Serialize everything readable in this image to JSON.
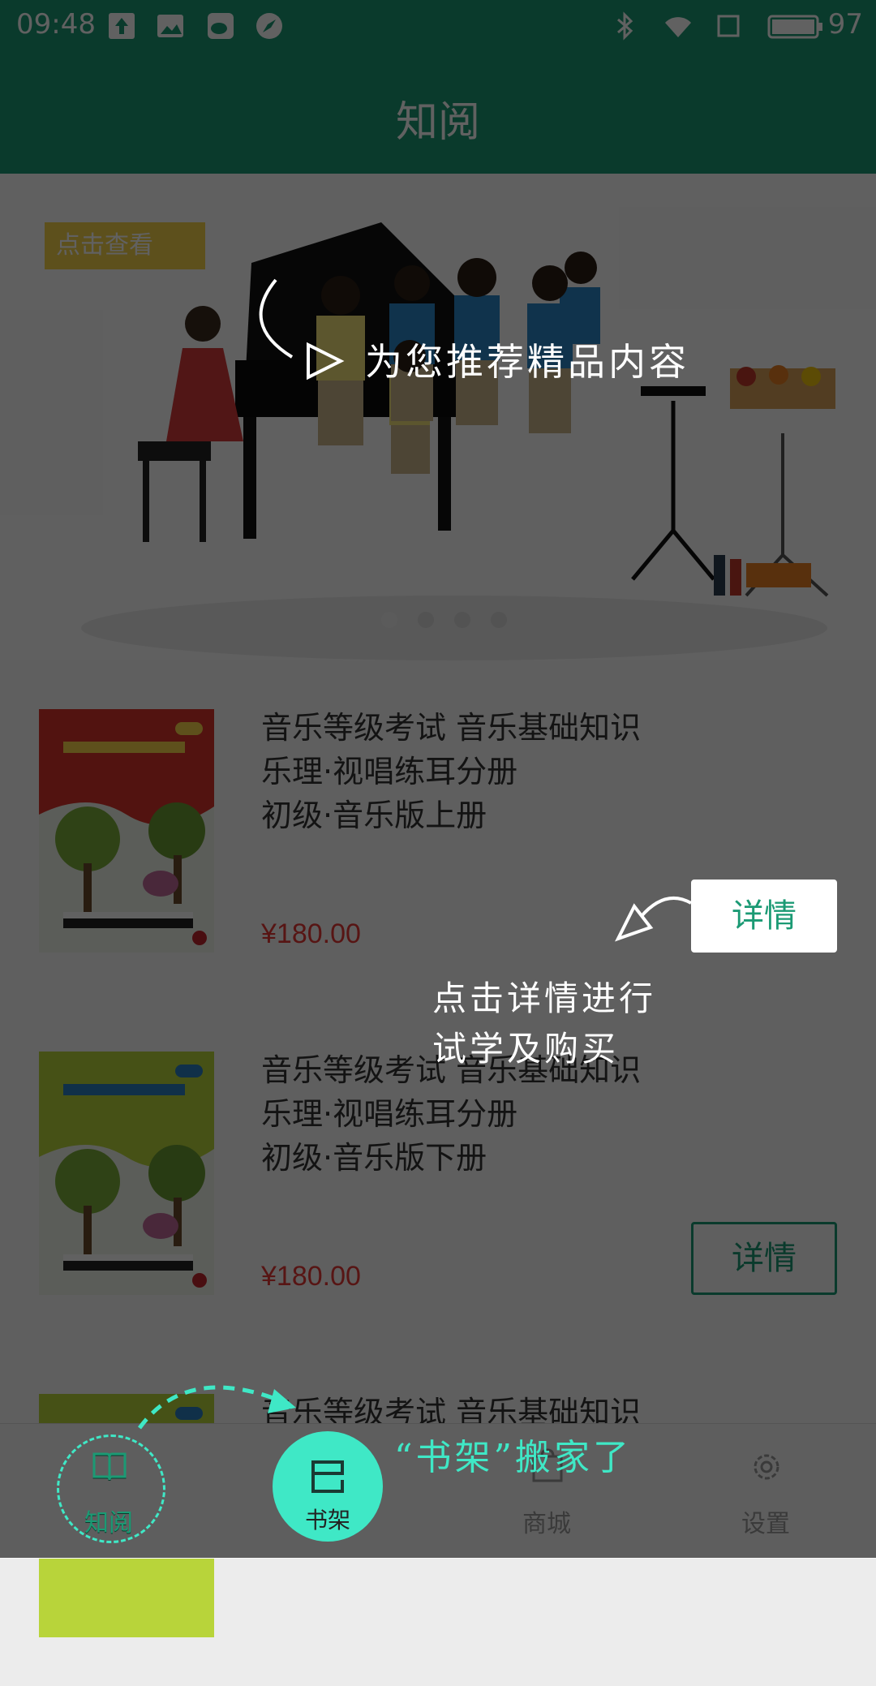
{
  "status_bar": {
    "time": "09:48",
    "battery": "97"
  },
  "app_bar": {
    "title": "知阅"
  },
  "banner": {
    "tag": "点击查看"
  },
  "books": [
    {
      "title": "音乐等级考试 音乐基础知识\n乐理·视唱练耳分册\n初级·音乐版上册",
      "price": "¥180.00",
      "detail": "详情"
    },
    {
      "title": "音乐等级考试 音乐基础知识\n乐理·视唱练耳分册\n初级·音乐版下册",
      "price": "¥180.00",
      "detail": "详情"
    },
    {
      "title": "音乐等级考试 音乐基础知识"
    }
  ],
  "tabs": [
    {
      "label": "知阅",
      "icon": "book-open-icon"
    },
    {
      "label": "书架",
      "icon": "bookshelf-icon"
    },
    {
      "label": "商城",
      "icon": "store-icon"
    },
    {
      "label": "设置",
      "icon": "gear-icon"
    }
  ],
  "guides": {
    "recommend": "为您推荐精品内容",
    "detail_hint": "点击详情进行\n试学及购买",
    "shelf_hint": "“书架”搬家了"
  },
  "colors": {
    "primary": "#1b9a74",
    "accent": "#3fe8c6",
    "price": "#e53935",
    "overlay": "rgba(0,0,0,0.62)"
  }
}
